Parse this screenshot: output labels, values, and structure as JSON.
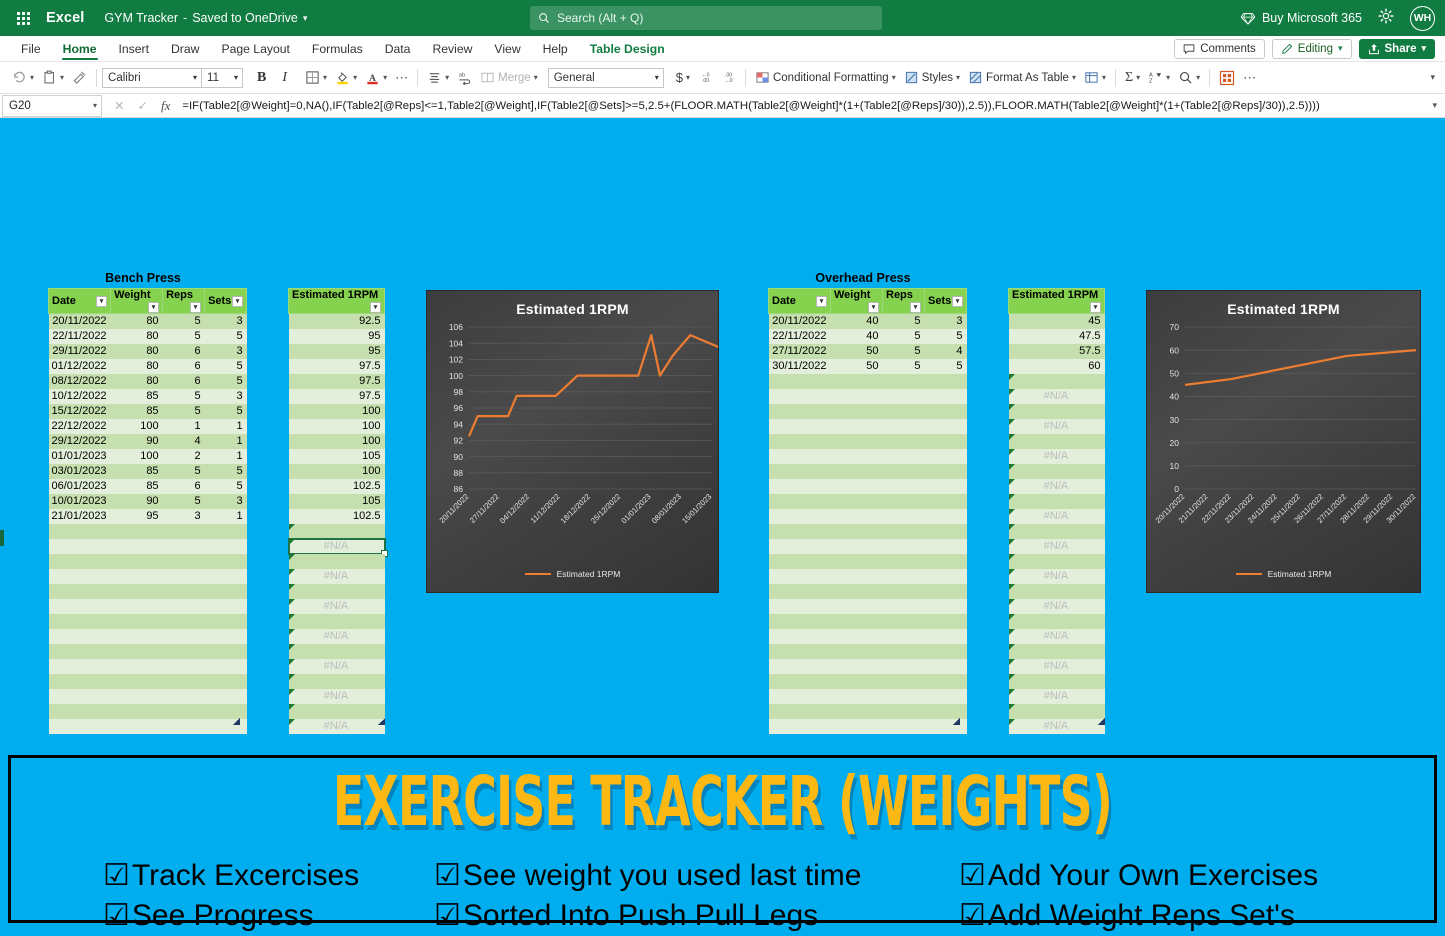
{
  "titlebar": {
    "app_name": "Excel",
    "doc_title": "GYM Tracker",
    "doc_sep": "-",
    "doc_status": "Saved to OneDrive",
    "search_placeholder": "Search (Alt + Q)",
    "buy_label": "Buy Microsoft 365",
    "avatar_initials": "WH",
    "icons": [
      "waffle-icon",
      "search-icon",
      "diamond-icon",
      "gear-icon"
    ]
  },
  "tabs": [
    {
      "label": "File",
      "active": false
    },
    {
      "label": "Home",
      "active": true
    },
    {
      "label": "Insert",
      "active": false
    },
    {
      "label": "Draw",
      "active": false
    },
    {
      "label": "Page Layout",
      "active": false
    },
    {
      "label": "Formulas",
      "active": false
    },
    {
      "label": "Data",
      "active": false
    },
    {
      "label": "Review",
      "active": false
    },
    {
      "label": "View",
      "active": false
    },
    {
      "label": "Help",
      "active": false
    },
    {
      "label": "Table Design",
      "active": false
    }
  ],
  "tabs_right": {
    "comments": "Comments",
    "editing": "Editing",
    "share": "Share"
  },
  "ribbon": {
    "undo": "undo-icon",
    "paste": "paste-icon",
    "format_painter": "format-painter-icon",
    "font_name": "Calibri",
    "font_size": "11",
    "bold": "B",
    "italic": "I",
    "borders": "borders-icon",
    "fill_color": "fill-color-icon",
    "font_color": "font-color-icon",
    "more": "⋯",
    "align": "align-icon",
    "wrap": "wrap-text-icon",
    "merge": "Merge",
    "number_format": "General",
    "currency": "$",
    "increase_decimal": "increase-decimal-icon",
    "decrease_decimal": "decrease-decimal-icon",
    "conditional_formatting": "Conditional Formatting",
    "styles": "Styles",
    "format_as_table": "Format As Table",
    "cells": "cells-icon",
    "autosum": "Σ",
    "sort_filter": "sort-filter-icon",
    "find": "find-icon",
    "addins": "addins-icon",
    "overflow": "⋯"
  },
  "formula_bar": {
    "name_box": "G20",
    "cancel": "cancel-icon",
    "enter": "enter-icon",
    "fx": "fx",
    "formula": "=IF(Table2[@Weight]=0,NA(),IF(Table2[@Reps]<=1,Table2[@Weight],IF(Table2[@Sets]>=5,2.5+(FLOOR.MATH(Table2[@Weight]*(1+(Table2[@Reps]/30)),2.5)),FLOOR.MATH(Table2[@Weight]*(1+(Table2[@Reps]/30)),2.5))))"
  },
  "sheet": {
    "background_color": "#00aeef",
    "bench_press": {
      "title": "Bench Press",
      "columns": [
        "Date",
        "Weight",
        "Reps",
        "Sets"
      ],
      "rows": [
        [
          "20/11/2022",
          "80",
          "5",
          "3"
        ],
        [
          "22/11/2022",
          "80",
          "5",
          "5"
        ],
        [
          "29/11/2022",
          "80",
          "6",
          "3"
        ],
        [
          "01/12/2022",
          "80",
          "6",
          "5"
        ],
        [
          "08/12/2022",
          "80",
          "6",
          "5"
        ],
        [
          "10/12/2022",
          "85",
          "5",
          "3"
        ],
        [
          "15/12/2022",
          "85",
          "5",
          "5"
        ],
        [
          "22/12/2022",
          "100",
          "1",
          "1"
        ],
        [
          "29/12/2022",
          "90",
          "4",
          "1"
        ],
        [
          "01/01/2023",
          "100",
          "2",
          "1"
        ],
        [
          "03/01/2023",
          "85",
          "5",
          "5"
        ],
        [
          "06/01/2023",
          "85",
          "6",
          "5"
        ],
        [
          "10/01/2023",
          "90",
          "5",
          "3"
        ],
        [
          "21/01/2023",
          "95",
          "3",
          "1"
        ]
      ],
      "empty_rows": 14
    },
    "bench_1rpm": {
      "column": "Estimated 1RPM",
      "values": [
        "92.5",
        "95",
        "95",
        "97.5",
        "97.5",
        "97.5",
        "100",
        "100",
        "100",
        "105",
        "100",
        "102.5",
        "105",
        "102.5"
      ],
      "na_label": "#N/A",
      "selected_cell": "G20"
    },
    "overhead_press": {
      "title": "Overhead Press",
      "columns": [
        "Date",
        "Weight",
        "Reps",
        "Sets"
      ],
      "rows": [
        [
          "20/11/2022",
          "40",
          "5",
          "3"
        ],
        [
          "22/11/2022",
          "40",
          "5",
          "5"
        ],
        [
          "27/11/2022",
          "50",
          "5",
          "4"
        ],
        [
          "30/11/2022",
          "50",
          "5",
          "5"
        ]
      ],
      "empty_rows": 24
    },
    "overhead_1rpm": {
      "column": "Estimated 1RPM",
      "values": [
        "45",
        "47.5",
        "57.5",
        "60"
      ],
      "na_label": "#N/A"
    }
  },
  "chart_data": [
    {
      "type": "line",
      "title": "Estimated 1RPM",
      "xlabel": "",
      "ylabel": "",
      "ylim": [
        86,
        106
      ],
      "yticks": [
        86,
        88,
        90,
        92,
        94,
        96,
        98,
        100,
        102,
        104,
        106
      ],
      "xticks": [
        "20/11/2022",
        "27/11/2022",
        "04/12/2022",
        "11/12/2022",
        "18/12/2022",
        "25/12/2022",
        "01/01/2023",
        "08/01/2023",
        "15/01/2023"
      ],
      "grid": true,
      "legend": [
        "Estimated 1RPM"
      ],
      "legend_position": "bottom",
      "series": [
        {
          "name": "Estimated 1RPM",
          "x": [
            "20/11/2022",
            "22/11/2022",
            "29/11/2022",
            "01/12/2022",
            "08/12/2022",
            "10/12/2022",
            "15/12/2022",
            "22/12/2022",
            "29/12/2022",
            "01/01/2023",
            "03/01/2023",
            "06/01/2023",
            "10/01/2023",
            "21/01/2023"
          ],
          "values": [
            92.5,
            95,
            95,
            97.5,
            97.5,
            97.5,
            100,
            100,
            100,
            105,
            100,
            102.5,
            105,
            102.5
          ]
        }
      ],
      "line_color": "#ed7d31",
      "plot_bg": "#404040"
    },
    {
      "type": "line",
      "title": "Estimated 1RPM",
      "xlabel": "",
      "ylabel": "",
      "ylim": [
        0,
        70
      ],
      "yticks": [
        0,
        10,
        20,
        30,
        40,
        50,
        60,
        70
      ],
      "xticks": [
        "20/11/2022",
        "21/11/2022",
        "22/11/2022",
        "23/11/2022",
        "24/11/2022",
        "25/11/2022",
        "26/11/2022",
        "27/11/2022",
        "28/11/2022",
        "29/11/2022",
        "30/11/2022"
      ],
      "grid": true,
      "legend": [
        "Estimated 1RPM"
      ],
      "legend_position": "bottom",
      "series": [
        {
          "name": "Estimated 1RPM",
          "x": [
            "20/11/2022",
            "22/11/2022",
            "27/11/2022",
            "30/11/2022"
          ],
          "values": [
            45,
            47.5,
            57.5,
            60
          ]
        }
      ],
      "line_color": "#ed7d31",
      "plot_bg": "#404040"
    }
  ],
  "banner": {
    "title": "EXERCISE TRACKER (WEIGHTS)",
    "check_glyph": "☑",
    "features": [
      "Track Excercises",
      "See weight you used last time",
      "Add Your Own Exercises",
      "See Progress",
      "Sorted Into Push Pull Legs",
      "Add Weight Reps Set's"
    ],
    "title_color": "#fdb813",
    "bg_color": "#00aeef"
  }
}
